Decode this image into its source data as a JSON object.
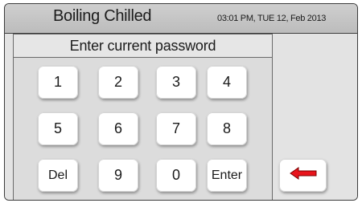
{
  "header": {
    "title": "Boiling Chilled",
    "datetime": "03:01 PM, TUE 12, Feb 2013"
  },
  "prompt": "Enter current password",
  "keypad": {
    "keys": [
      "1",
      "2",
      "3",
      "4",
      "5",
      "6",
      "7",
      "8",
      "Del",
      "9",
      "0",
      "Enter"
    ]
  },
  "back_button": {
    "icon": "red-left-arrow-icon",
    "color": "#e8141c"
  }
}
